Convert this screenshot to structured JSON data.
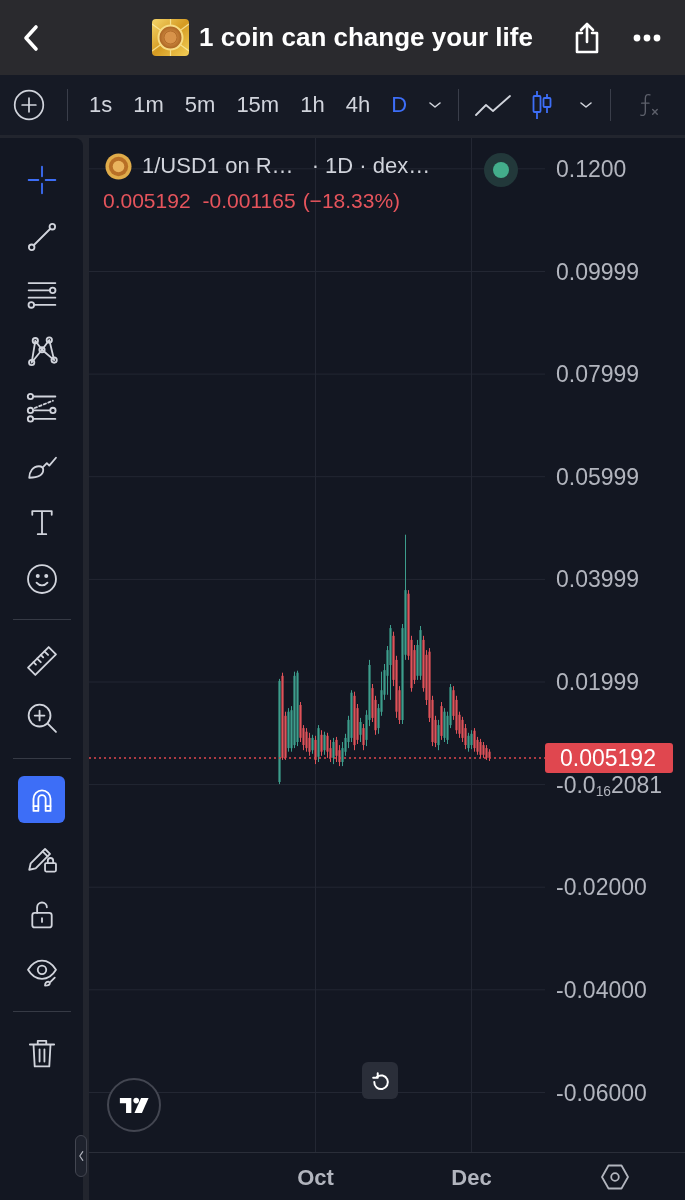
{
  "header": {
    "title": "1 coin can change your life"
  },
  "toolbar": {
    "intervals": [
      {
        "label": "1s",
        "selected": false
      },
      {
        "label": "1m",
        "selected": false
      },
      {
        "label": "5m",
        "selected": false
      },
      {
        "label": "15m",
        "selected": false
      },
      {
        "label": "1h",
        "selected": false
      },
      {
        "label": "4h",
        "selected": false
      },
      {
        "label": "D",
        "selected": true
      }
    ],
    "chart_types": [
      {
        "kind": "line",
        "selected": false
      },
      {
        "kind": "candles",
        "selected": true
      }
    ]
  },
  "drawing_tools": {
    "tool_groups": [
      {
        "tools": [
          {
            "kind": "crosshair",
            "selected": true
          },
          {
            "kind": "trend-line",
            "selected": false
          },
          {
            "kind": "horizontal-lines",
            "selected": false
          },
          {
            "kind": "pattern",
            "selected": false
          },
          {
            "kind": "fib",
            "selected": false
          },
          {
            "kind": "brush",
            "selected": false
          },
          {
            "kind": "text",
            "selected": false
          },
          {
            "kind": "emoji",
            "selected": false
          }
        ]
      },
      {
        "tools": [
          {
            "kind": "ruler",
            "selected": false
          },
          {
            "kind": "zoom",
            "selected": false
          }
        ]
      }
    ],
    "toggles": [
      {
        "kind": "magnet",
        "on": true
      },
      {
        "kind": "pencil-lock",
        "on": false
      },
      {
        "kind": "lock",
        "on": false
      },
      {
        "kind": "eye",
        "on": false
      }
    ],
    "actions": [
      {
        "kind": "trash"
      }
    ]
  },
  "chart": {
    "legend": {
      "symbol": "1/USD1 on R…",
      "details": "· 1D · dex…",
      "last": "0.005192",
      "change": "-0.001165",
      "change_percent": "(−18.33%)"
    },
    "chart_data": {
      "type": "candlestick",
      "grid": true,
      "categories": [
        null,
        null,
        null,
        null,
        null,
        null,
        null,
        null,
        null,
        null,
        null,
        null,
        null,
        null,
        null,
        null,
        null,
        null,
        null,
        null,
        null,
        null,
        null,
        null,
        null,
        null,
        null,
        null,
        null,
        null,
        null,
        null,
        null,
        null,
        null,
        null,
        null,
        null,
        null,
        null,
        null,
        null,
        null,
        null,
        null,
        null,
        null,
        null,
        null,
        null,
        null,
        null,
        null,
        null,
        null,
        null,
        null,
        null,
        null,
        null,
        null,
        null,
        null,
        null,
        null,
        null,
        null,
        null,
        null,
        null,
        null,
        null,
        null,
        null,
        null,
        "Oct",
        null,
        null,
        null,
        null,
        null,
        null,
        null,
        null,
        null,
        null,
        null,
        null,
        null,
        null,
        null,
        null,
        null,
        null,
        null,
        null,
        null,
        null,
        null,
        null,
        null,
        null,
        null,
        null,
        null,
        null,
        null,
        null,
        null,
        null,
        null,
        null,
        null,
        null,
        null,
        null,
        null,
        null,
        null,
        null,
        null,
        null,
        null,
        null,
        null,
        null,
        null,
        "Dec",
        null,
        null,
        null,
        null,
        null,
        null,
        null,
        null,
        null,
        null,
        null,
        null,
        null,
        null,
        null,
        null,
        null,
        null,
        null,
        null,
        null,
        null,
        null,
        null
      ],
      "ohlc": [
        null,
        null,
        null,
        null,
        null,
        null,
        null,
        null,
        null,
        null,
        null,
        null,
        null,
        null,
        null,
        null,
        null,
        null,
        null,
        null,
        null,
        null,
        null,
        null,
        null,
        null,
        null,
        null,
        null,
        null,
        null,
        null,
        null,
        null,
        null,
        null,
        null,
        null,
        null,
        null,
        null,
        null,
        null,
        null,
        null,
        null,
        null,
        null,
        null,
        null,
        null,
        null,
        null,
        null,
        null,
        null,
        null,
        null,
        null,
        null,
        null,
        null,
        null,
        [
          0.0005,
          0.0206,
          0.0001,
          0.0202
        ],
        [
          0.0212,
          0.0218,
          0.0048,
          0.0052
        ],
        [
          0.0134,
          0.0142,
          0.0048,
          0.0052
        ],
        [
          0.0071,
          0.0149,
          0.0064,
          0.0142
        ],
        [
          0.0071,
          0.0153,
          0.0064,
          0.0145
        ],
        [
          0.0077,
          0.022,
          0.0071,
          0.0212
        ],
        [
          0.0083,
          0.0222,
          0.0075,
          0.0218
        ],
        [
          0.0155,
          0.0161,
          0.0083,
          0.0091
        ],
        [
          0.011,
          0.0116,
          0.0067,
          0.0077
        ],
        [
          0.0103,
          0.011,
          0.0064,
          0.0071
        ],
        [
          0.0091,
          0.0101,
          0.0056,
          0.0064
        ],
        [
          0.0067,
          0.0097,
          0.006,
          0.0091
        ],
        [
          0.0087,
          0.0095,
          0.004,
          0.0048
        ],
        [
          0.0054,
          0.0116,
          0.0044,
          0.011
        ],
        [
          0.0097,
          0.0106,
          0.0056,
          0.0064
        ],
        [
          0.0067,
          0.0103,
          0.0058,
          0.0097
        ],
        [
          0.0095,
          0.0101,
          0.0052,
          0.0064
        ],
        [
          0.0071,
          0.0087,
          0.0044,
          0.0052
        ],
        [
          0.0052,
          0.0091,
          0.004,
          0.0083
        ],
        [
          0.0087,
          0.0093,
          0.0044,
          0.0056
        ],
        [
          0.0067,
          0.0077,
          0.0036,
          0.0044
        ],
        [
          0.0044,
          0.0083,
          0.0036,
          0.0071
        ],
        [
          0.0064,
          0.0099,
          0.0056,
          0.0091
        ],
        [
          0.0083,
          0.0134,
          0.0071,
          0.0126
        ],
        [
          0.0091,
          0.0184,
          0.0083,
          0.0179
        ],
        [
          0.0173,
          0.0181,
          0.0067,
          0.0077
        ],
        [
          0.0149,
          0.0157,
          0.0079,
          0.0087
        ],
        [
          0.0097,
          0.013,
          0.0083,
          0.0122
        ],
        [
          0.011,
          0.0118,
          0.0067,
          0.0077
        ],
        [
          0.0087,
          0.0145,
          0.0075,
          0.0136
        ],
        [
          0.0126,
          0.0243,
          0.0114,
          0.0233
        ],
        [
          0.0188,
          0.0196,
          0.0122,
          0.013
        ],
        [
          0.0165,
          0.0173,
          0.0097,
          0.0106
        ],
        [
          0.011,
          0.0157,
          0.0099,
          0.0149
        ],
        [
          0.0142,
          0.022,
          0.0134,
          0.0184
        ],
        [
          0.0175,
          0.0235,
          0.0165,
          0.0223
        ],
        [
          0.0212,
          0.027,
          0.0175,
          0.0262
        ],
        [
          0.0233,
          0.0311,
          0.0165,
          0.0305
        ],
        [
          0.029,
          0.0298,
          0.0192,
          0.0204
        ],
        [
          0.0243,
          0.0251,
          0.013,
          0.0142
        ],
        [
          0.0184,
          0.0192,
          0.0118,
          0.0126
        ],
        [
          0.0126,
          0.0313,
          0.0118,
          0.0305
        ],
        [
          0.0253,
          0.0487,
          0.0243,
          0.0379
        ],
        [
          0.0372,
          0.0379,
          0.0243,
          0.0251
        ],
        [
          0.0282,
          0.029,
          0.0181,
          0.0188
        ],
        [
          0.0262,
          0.0272,
          0.0196,
          0.0204
        ],
        [
          0.0212,
          0.0282,
          0.0204,
          0.0272
        ],
        [
          0.0212,
          0.0309,
          0.0204,
          0.0301
        ],
        [
          0.0282,
          0.029,
          0.0181,
          0.0188
        ],
        [
          0.0253,
          0.0262,
          0.0155,
          0.0165
        ],
        [
          0.0259,
          0.0266,
          0.0122,
          0.013
        ],
        [
          0.0165,
          0.0173,
          0.0075,
          0.0083
        ],
        [
          0.0126,
          0.0134,
          0.0073,
          0.0081
        ],
        [
          0.0077,
          0.0126,
          0.0067,
          0.0116
        ],
        [
          0.0153,
          0.0161,
          0.0087,
          0.0095
        ],
        [
          0.0091,
          0.0149,
          0.0083,
          0.0142
        ],
        [
          0.0087,
          0.0142,
          0.0079,
          0.0134
        ],
        [
          0.0116,
          0.0196,
          0.011,
          0.019
        ],
        [
          0.0184,
          0.0192,
          0.0126,
          0.0134
        ],
        [
          0.0165,
          0.0173,
          0.0099,
          0.0106
        ],
        [
          0.0136,
          0.0142,
          0.0091,
          0.0099
        ],
        [
          0.0126,
          0.0132,
          0.0083,
          0.0091
        ],
        [
          0.011,
          0.0118,
          0.0069,
          0.0077
        ],
        [
          0.0071,
          0.0101,
          0.0064,
          0.0095
        ],
        [
          0.0077,
          0.0106,
          0.0069,
          0.0099
        ],
        [
          0.0105,
          0.011,
          0.0064,
          0.0071
        ],
        [
          0.0087,
          0.0093,
          0.0058,
          0.0064
        ],
        [
          0.0083,
          0.0089,
          0.0052,
          0.0058
        ],
        [
          0.0077,
          0.0083,
          0.0052,
          0.0058
        ],
        [
          0.0071,
          0.0077,
          0.0048,
          0.0052
        ],
        [
          0.0064,
          0.0069,
          0.0046,
          0.005192
        ],
        null,
        null,
        null,
        null,
        null,
        null,
        null,
        null,
        null,
        null,
        null,
        null,
        null,
        null,
        null,
        null,
        null,
        null
      ],
      "ylim": [
        -0.0716,
        0.126
      ],
      "yticks": [
        {
          "value": 0.12,
          "label": "0.1200"
        },
        {
          "value": 0.09999,
          "label": "0.09999"
        },
        {
          "value": 0.07999,
          "label": "0.07999"
        },
        {
          "value": 0.05999,
          "label": "0.05999"
        },
        {
          "value": 0.03999,
          "label": "0.03999"
        },
        {
          "value": 0.01999,
          "label": "0.01999"
        },
        {
          "value": -2.081e-17,
          "label": "-0.0$_{16}$2081"
        },
        {
          "value": -0.02,
          "label": "-0.02000"
        },
        {
          "value": -0.04,
          "label": "-0.04000"
        },
        {
          "value": -0.06,
          "label": "-0.06000"
        }
      ],
      "ref_lines": [
        {
          "axis": "y",
          "value": 0.005192,
          "label": "0.005192"
        }
      ]
    }
  }
}
